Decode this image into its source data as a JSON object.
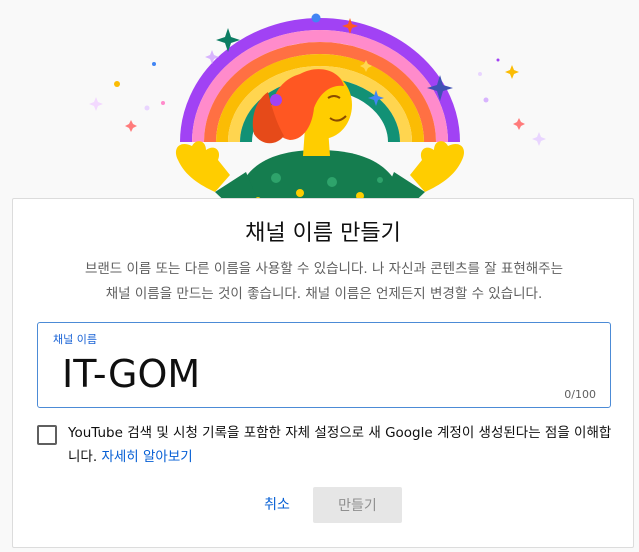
{
  "dialog": {
    "title": "채널 이름 만들기",
    "description_line1": "브랜드 이름 또는 다른 이름을 사용할 수 있습니다. 나 자신과 콘텐츠를 잘 표현해주는",
    "description_line2": "채널 이름을 만드는 것이 좋습니다. 채널 이름은 언제든지 변경할 수 있습니다.",
    "name_field": {
      "label": "채널 이름",
      "value": "IT-GOM",
      "counter": "0/100"
    },
    "consent": {
      "text": "YouTube 검색 및 시청 기록을 포함한 자체 설정으로 새 Google 계정이 생성된다는 점을 이해합니다. ",
      "link": "자세히 알아보기",
      "checked": false
    },
    "buttons": {
      "cancel": "취소",
      "create": "만들기"
    }
  },
  "colors": {
    "accent": "#065fd4",
    "field_border": "#4c8bd6",
    "rainbow": [
      "#a142f4",
      "#ff8bcb",
      "#ff7043",
      "#fbbc04",
      "#ffd54f",
      "#129175",
      "#0d7d63"
    ],
    "skin": "#ffcd00",
    "hair": "#ff5722",
    "shirt": "#157d4f"
  },
  "icons": {
    "sparkles": "sparkle-icon",
    "checkbox": "checkbox-icon"
  }
}
